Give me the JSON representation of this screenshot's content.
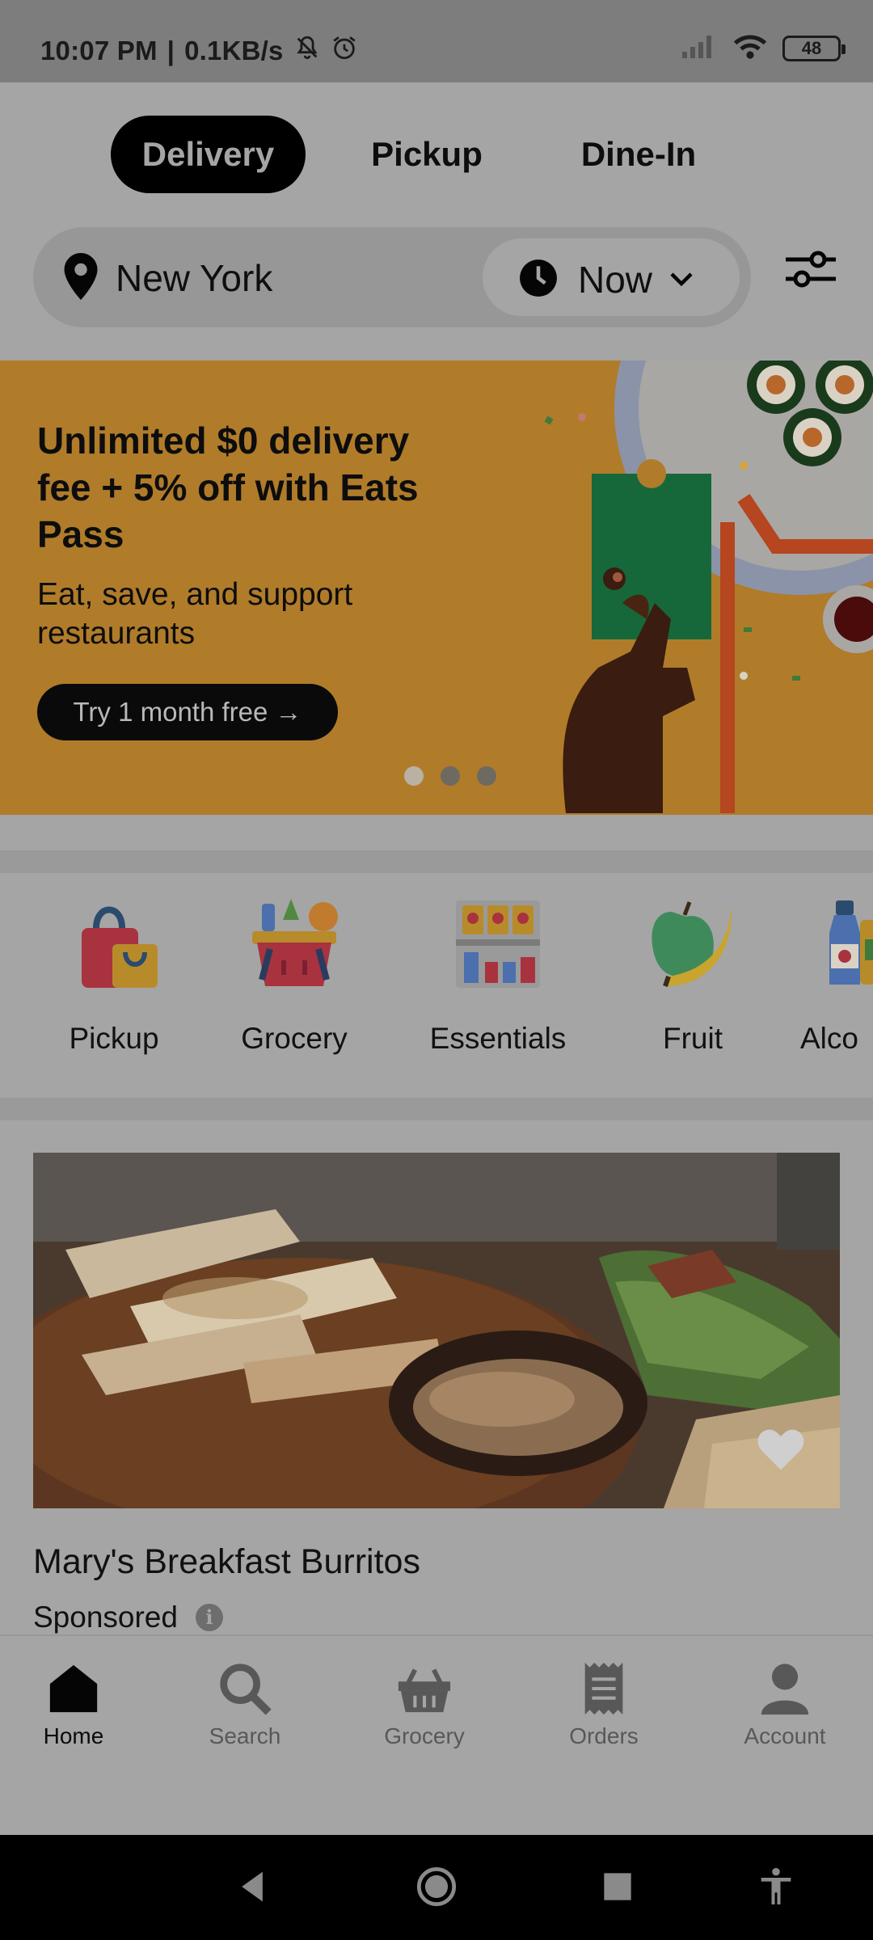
{
  "status_bar": {
    "time": "10:07 PM",
    "network_speed": "0.1KB/s",
    "separator": "|",
    "battery": "48",
    "icons": [
      "mute-bell-icon",
      "alarm-icon",
      "signal-icon",
      "wifi-icon",
      "battery-icon"
    ]
  },
  "modes": [
    {
      "label": "Delivery",
      "active": true
    },
    {
      "label": "Pickup",
      "active": false
    },
    {
      "label": "Dine-In",
      "active": false
    }
  ],
  "location": {
    "city": "New York",
    "time": "Now"
  },
  "promo": {
    "title": "Unlimited $0 delivery fee + 5% off with Eats Pass",
    "subtitle": "Eat, save, and support restaurants",
    "button": "Try 1 month free →",
    "slides": 3,
    "active_slide": 1
  },
  "categories": [
    {
      "label": "Pickup",
      "icon": "shopping-bag-icon"
    },
    {
      "label": "Grocery",
      "icon": "grocery-basket-icon"
    },
    {
      "label": "Essentials",
      "icon": "essentials-shelf-icon"
    },
    {
      "label": "Fruit",
      "icon": "fruit-icon"
    },
    {
      "label": "Alco",
      "icon": "alcohol-bottle-icon"
    }
  ],
  "restaurant": {
    "name": "Mary's Breakfast Burritos",
    "sponsored": "Sponsored"
  },
  "bottom_nav": [
    {
      "label": "Home",
      "icon": "home-icon",
      "active": true
    },
    {
      "label": "Search",
      "icon": "search-icon",
      "active": false
    },
    {
      "label": "Grocery",
      "icon": "grocery-basket-icon",
      "active": false
    },
    {
      "label": "Orders",
      "icon": "receipt-icon",
      "active": false
    },
    {
      "label": "Account",
      "icon": "person-icon",
      "active": false
    }
  ],
  "colors": {
    "background": "#a5a5a5",
    "banner": "#b07c2a",
    "active_tab": "#000000"
  }
}
